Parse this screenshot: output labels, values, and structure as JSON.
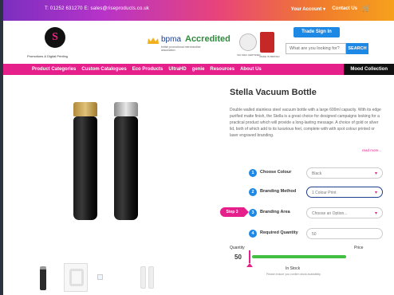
{
  "topbar": {
    "contact": "T: 01252 631270  E: sales@riseproducts.co.uk",
    "account": "Your Account",
    "contact_us": "Contact Us",
    "cart_icon": "cart-icon"
  },
  "header": {
    "logo_letter": "S",
    "logo_tagline": "Promotions & Digital Printing",
    "accreditation": {
      "brand": "bpma",
      "label": "Accredited",
      "sub": "british promotional merchandise association"
    },
    "badge1": "ISO 9001 CERTIFIED",
    "badge2": "MADE IN BRITAIN",
    "signin": "Trade Sign In",
    "search_placeholder": "What are you looking for?",
    "search_button": "SEARCH"
  },
  "nav": [
    "Product Categories",
    "Custom Catalogues",
    "Eco Products",
    "UltraHD",
    "genie",
    "Resources",
    "About Us",
    "Mood Collection"
  ],
  "product": {
    "title": "Stella Vacuum Bottle",
    "description": "Double walled stainless steel vacuum bottle with a large 600ml capacity. With its edge purified matte finish, the Stella is a great choice for designed campaigns looking for a practical product which will provide a long-lasting message. A choice of gold or silver lid, both of which add to its luxurious feel, complete with with spot colour printed or laser engraved branding.",
    "read_more": "read more...",
    "options": [
      {
        "num": "1",
        "label": "Choose Colour",
        "value": "Black"
      },
      {
        "num": "2",
        "label": "Branding Method",
        "value": "1 Colour Print"
      },
      {
        "num": "3",
        "label": "Branding Area",
        "value": "Choose an Option..."
      },
      {
        "num": "4",
        "label": "Required Quantity",
        "value": "50"
      }
    ],
    "step_tag": "Step 3",
    "quantity_label": "Quantity",
    "quantity_value": "50",
    "price_label": "Price",
    "stock": "In Stock",
    "note": "Please ensure you confirm stock availability."
  }
}
